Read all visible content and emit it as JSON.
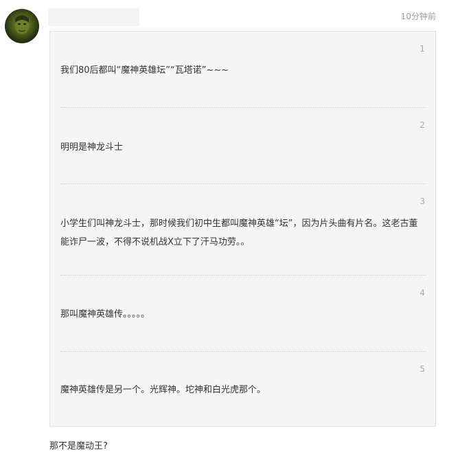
{
  "comment": {
    "time": "10分钟前",
    "floors": [
      {
        "num": "1",
        "text": "我们80后都叫“魔神英雄坛”“瓦塔诺”~~~"
      },
      {
        "num": "2",
        "text": "明明是神龙斗士"
      },
      {
        "num": "3",
        "text": "小学生们叫神龙斗士，那时候我们初中生都叫魔神英雄“坛”，因为片头曲有片名。这老古董能诈尸一波，不得不说机战X立下了汗马功劳。。"
      },
      {
        "num": "4",
        "text": "那叫魔神英雄传。。。。。"
      },
      {
        "num": "5",
        "text": "魔神英雄传是另一个。光辉神。坨神和白光虎那个。"
      }
    ],
    "reply": "那不是魔动王?"
  }
}
